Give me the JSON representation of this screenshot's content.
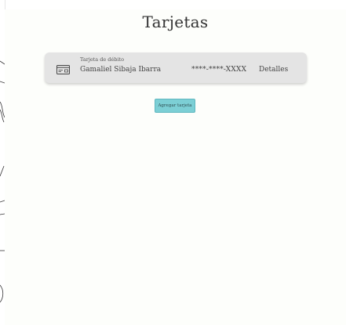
{
  "page": {
    "title": "Tarjetas"
  },
  "card": {
    "type_label": "Tarjeta de débito",
    "holder": "Gamaliel Sibaja Ibarra",
    "number": "****-****-XXXX",
    "details_label": "Detalles",
    "icon": "credit-card-icon"
  },
  "actions": {
    "add_card_label": "Agregar tarjeta"
  },
  "colors": {
    "card_bg": "#e4e4e4",
    "button_bg": "#7ccfd5",
    "page_bg": "#fdfefb"
  }
}
